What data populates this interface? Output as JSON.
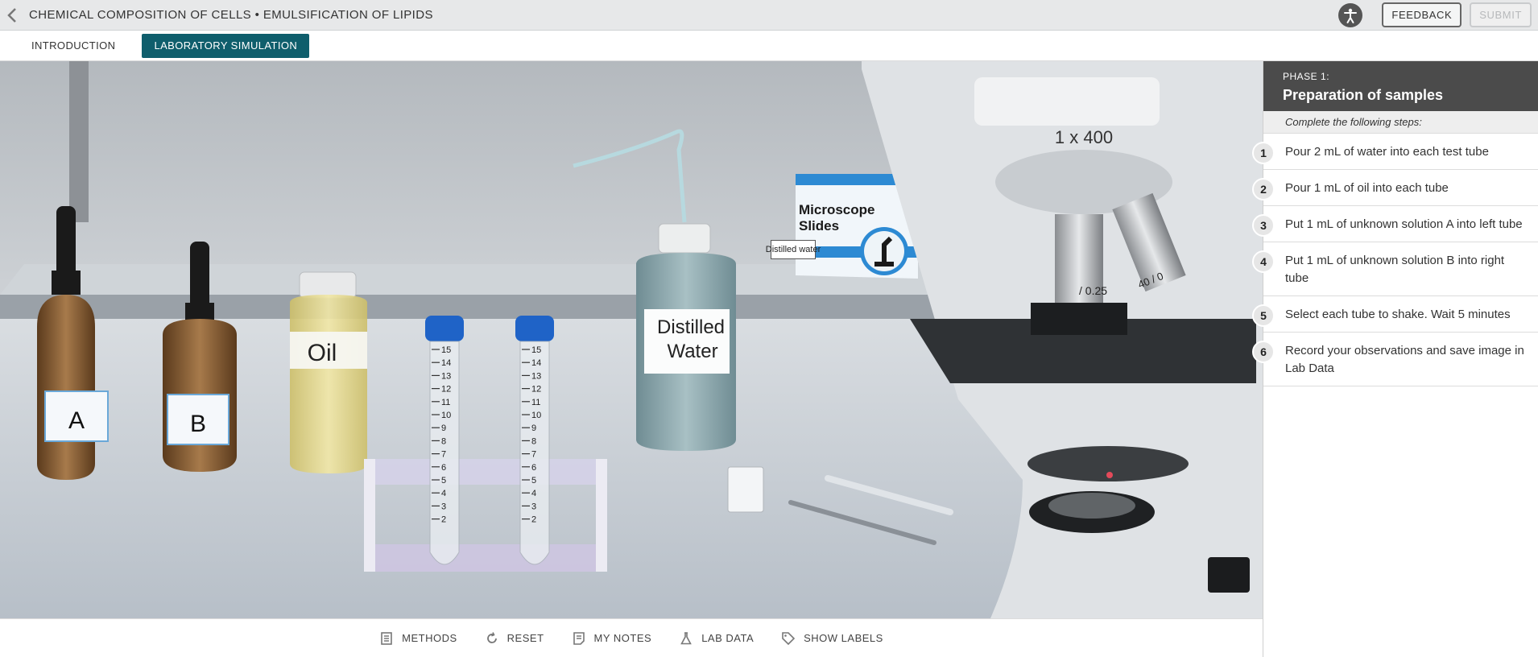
{
  "header": {
    "title": "CHEMICAL COMPOSITION OF CELLS • EMULSIFICATION OF LIPIDS",
    "feedback_label": "FEEDBACK",
    "submit_label": "SUBMIT"
  },
  "tabs": [
    {
      "label": "INTRODUCTION"
    },
    {
      "label": "LABORATORY SIMULATION"
    }
  ],
  "scene": {
    "bottle_a_label": "A",
    "bottle_b_label": "B",
    "oil_label": "Oil",
    "water_label_line1": "Distilled",
    "water_label_line2": "Water",
    "slides_label_line1": "Microscope",
    "slides_label_line2": "Slides",
    "microscope_mag": "1 x 400",
    "objective_1": "/ 0.25",
    "objective_2": "40 / 0",
    "tooltip": "Distilled water",
    "tube_marks": [
      "15",
      "14",
      "13",
      "12",
      "11",
      "10",
      "9",
      "8",
      "7",
      "6",
      "5",
      "4",
      "3",
      "2"
    ]
  },
  "toolbar": {
    "methods": "METHODS",
    "reset": "RESET",
    "notes": "MY NOTES",
    "lab_data": "LAB DATA",
    "labels": "SHOW LABELS"
  },
  "panel": {
    "phase_label": "PHASE 1:",
    "phase_title": "Preparation of samples",
    "instructions": "Complete the following steps:",
    "steps": [
      {
        "num": "1",
        "text": "Pour 2 mL of water into each test tube"
      },
      {
        "num": "2",
        "text": "Pour 1 mL of oil into each tube"
      },
      {
        "num": "3",
        "text": "Put 1 mL of unknown solution A into left tube"
      },
      {
        "num": "4",
        "text": "Put 1 mL of unknown solution B into right tube"
      },
      {
        "num": "5",
        "text": "Select each tube to shake. Wait 5 minutes"
      },
      {
        "num": "6",
        "text": "Record your observations and save image in Lab Data"
      }
    ]
  }
}
